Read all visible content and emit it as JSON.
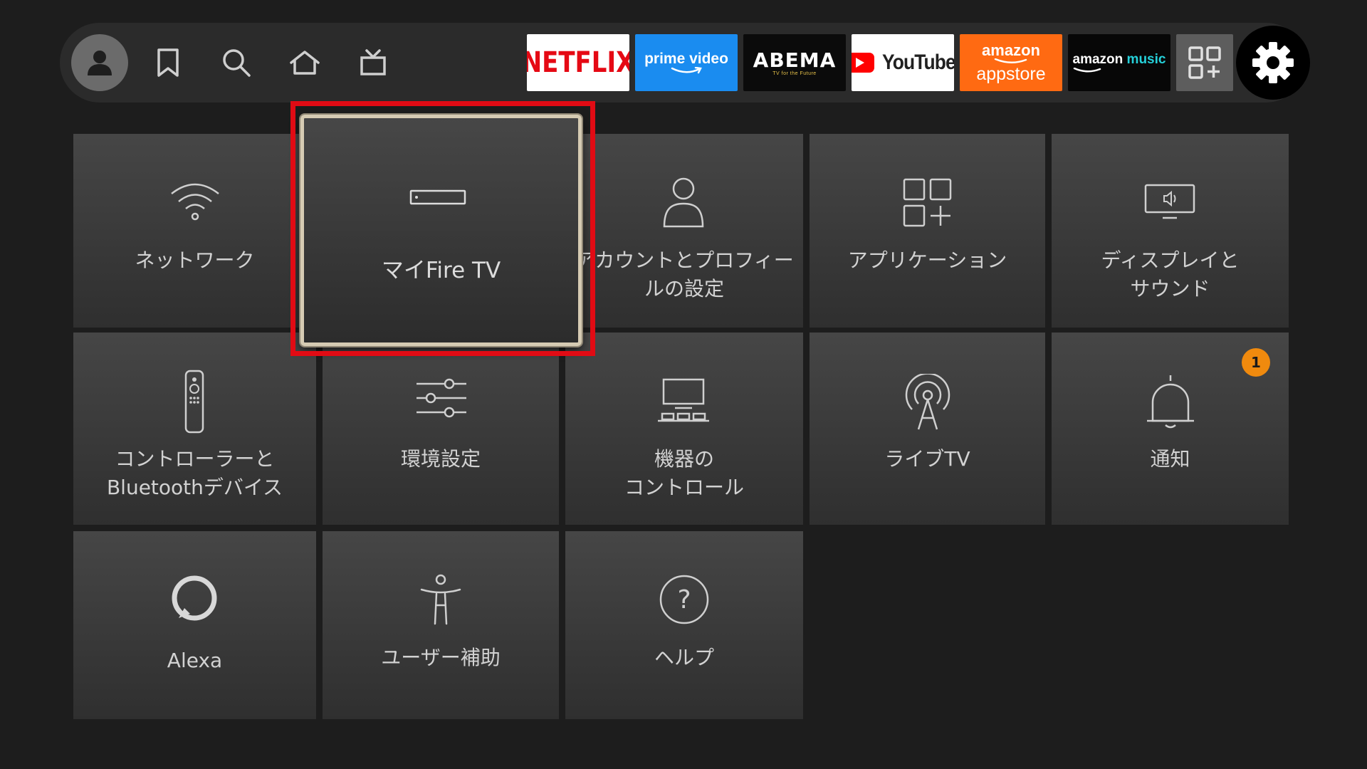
{
  "navbar": {
    "apps": {
      "netflix": "NETFLIX",
      "prime": "prime video",
      "abema": "ABEMA",
      "abema_sub": "TV for the Future",
      "youtube": "YouTube",
      "appstore_brand": "amazon",
      "appstore_name": "appstore",
      "music_brand": "amazon",
      "music_word": "music"
    }
  },
  "tiles": {
    "network": "ネットワーク",
    "my_fire_tv": "マイFire TV",
    "account": "アカウントとプロフィー\nルの設定",
    "applications": "アプリケーション",
    "display_sound": "ディスプレイと\nサウンド",
    "controllers": "コントローラーと\nBluetoothデバイス",
    "preferences": "環境設定",
    "equipment": "機器の\nコントロール",
    "live_tv": "ライブTV",
    "notifications": "通知",
    "notifications_badge": "1",
    "alexa": "Alexa",
    "accessibility": "ユーザー補助",
    "help": "ヘルプ"
  },
  "colors": {
    "focus_highlight": "#e10b14",
    "badge": "#f08a0e",
    "netflix_red": "#e50914",
    "prime_blue": "#1a8cf0",
    "appstore_orange": "#ff6a12",
    "music_cyan": "#25d1da"
  }
}
